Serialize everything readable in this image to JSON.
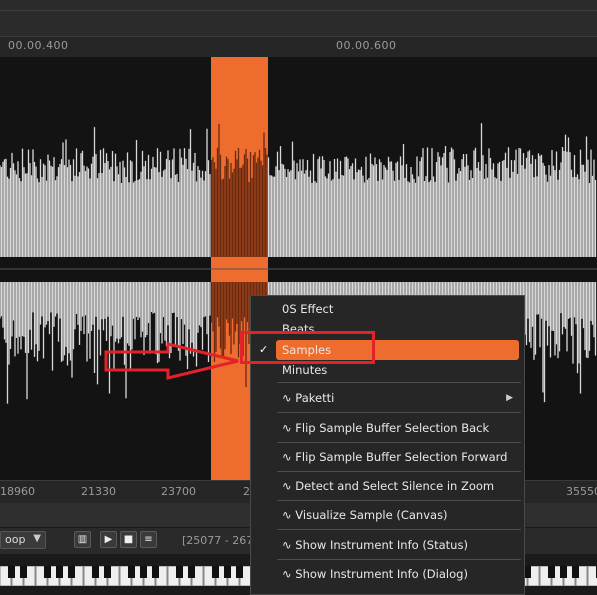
{
  "ruler": {
    "ticks": [
      "00.00.400",
      "00.00.600"
    ]
  },
  "sample_ruler": {
    "ticks": [
      "18960",
      "21330",
      "23700",
      "2",
      "35550"
    ]
  },
  "controls": {
    "loop_mode": "oop",
    "range_text": "[25077 - 267"
  },
  "context_menu": {
    "items": [
      {
        "label": "0S Effect"
      },
      {
        "label": "Beats"
      },
      {
        "label": "Samples",
        "checked": true,
        "highlighted": true
      },
      {
        "label": "Minutes"
      },
      {
        "label": "∿ Paketti",
        "submenu": true
      },
      {
        "label": "∿ Flip Sample Buffer Selection Back"
      },
      {
        "label": "∿ Flip Sample Buffer Selection Forward"
      },
      {
        "label": "∿ Detect and Select Silence in Zoom"
      },
      {
        "label": "∿ Visualize Sample (Canvas)"
      },
      {
        "label": "∿ Show Instrument Info (Status)"
      },
      {
        "label": "∿ Show Instrument Info (Dialog)"
      }
    ],
    "check_glyph": "✓",
    "submenu_glyph": "▶"
  },
  "colors": {
    "selection": "#ef6c2f",
    "waveform": "#d9d9d9",
    "annotation": "#e3222a"
  }
}
